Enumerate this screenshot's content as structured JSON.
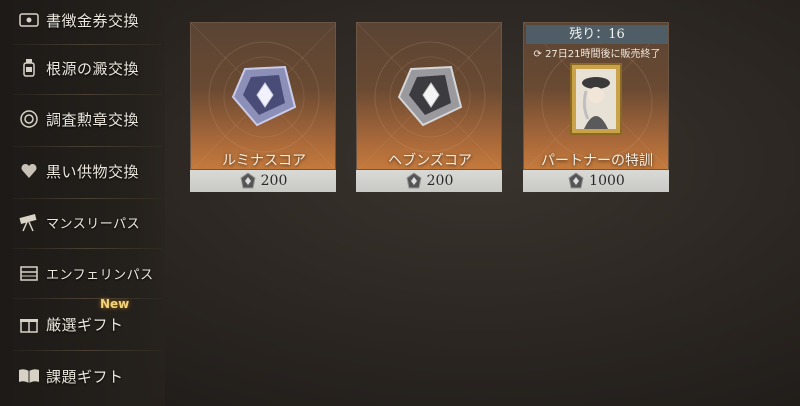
{
  "sidebar": {
    "items": [
      {
        "label": "書徴金券交換",
        "icon": "ticket-icon"
      },
      {
        "label": "根源の澱交換",
        "icon": "bottle-icon"
      },
      {
        "label": "調査勲章交換",
        "icon": "medal-icon"
      },
      {
        "label": "黒い供物交換",
        "icon": "heart-offering-icon"
      },
      {
        "label": "マンスリーパス",
        "icon": "telescope-icon"
      },
      {
        "label": "エンフェリンパス",
        "icon": "chest-icon"
      },
      {
        "label": "厳選ギフト",
        "icon": "gift-icon"
      },
      {
        "label": "課題ギフト",
        "icon": "book-icon"
      }
    ],
    "new_badge": "New"
  },
  "shop": {
    "items": [
      {
        "name": "ルミナスコア",
        "price": "200",
        "icon": "luminous-core-icon"
      },
      {
        "name": "ヘブンズコア",
        "price": "200",
        "icon": "heavens-core-icon"
      },
      {
        "name": "パートナーの特訓",
        "price": "1000",
        "icon": "partner-portrait-icon",
        "remaining": "残り：16",
        "deadline": "27日21時間後に販売終了"
      }
    ]
  },
  "colors": {
    "accent_orange": "#c47a3c",
    "price_bar": "#d0d0cd",
    "remain_bar": "#4f5e66",
    "badge": "#f2d27a"
  }
}
